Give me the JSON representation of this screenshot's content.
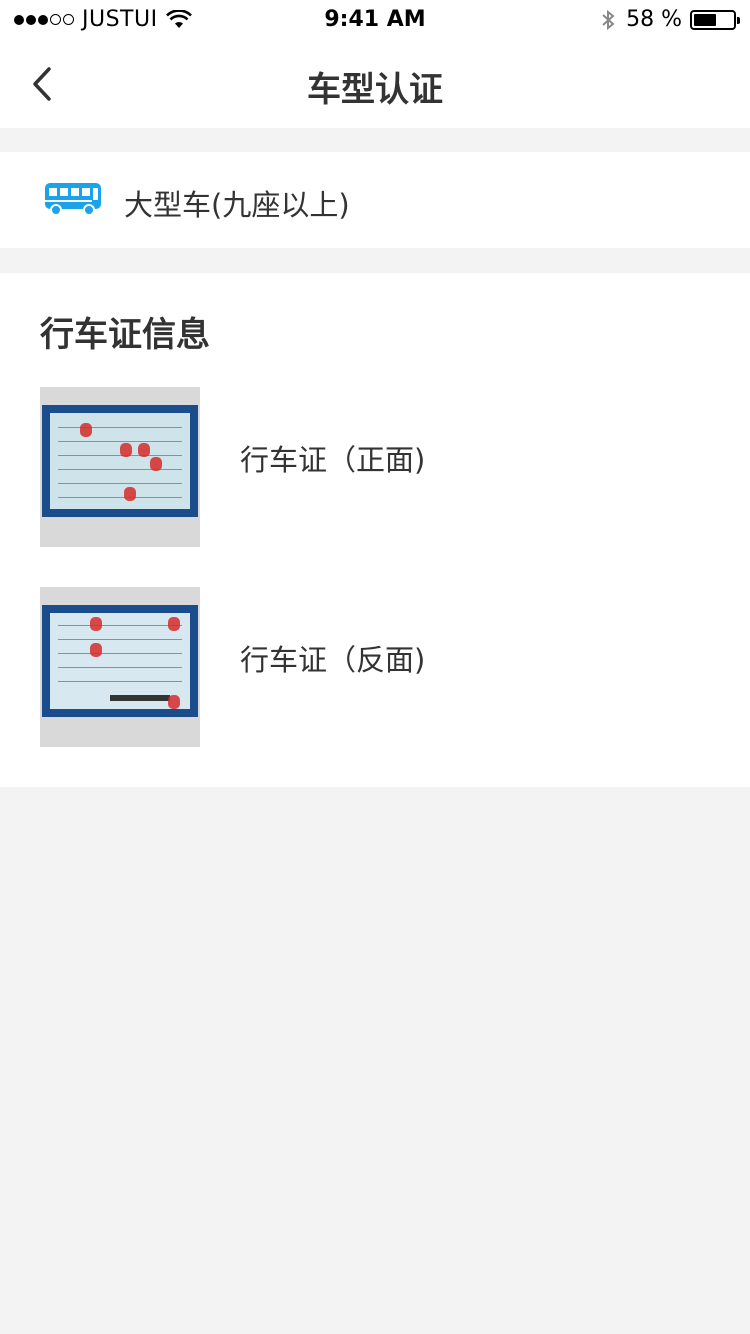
{
  "status_bar": {
    "carrier": "JUSTUI",
    "time": "9:41 AM",
    "battery_text": "58 %",
    "battery_level": 0.58,
    "signal_strength": 3
  },
  "nav": {
    "title": "车型认证",
    "back_icon": "chevron-left-icon"
  },
  "car_type": {
    "icon": "bus-icon",
    "label": "大型车(九座以上)",
    "icon_color": "#1aa3e8"
  },
  "license_section": {
    "title": "行车证信息",
    "items": [
      {
        "label": "行车证（正面)",
        "image": "license-front-image"
      },
      {
        "label": "行车证（反面)",
        "image": "license-back-image"
      }
    ]
  }
}
